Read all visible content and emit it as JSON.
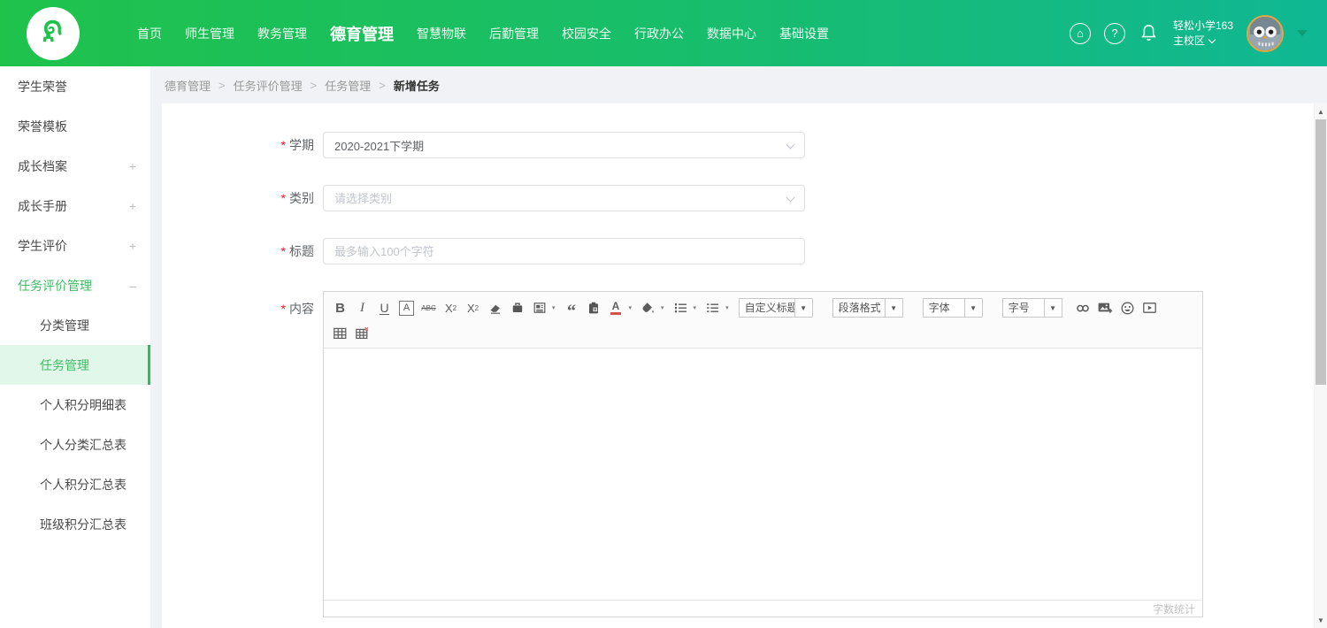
{
  "topnav": {
    "logo": "elephant-logo",
    "items": [
      {
        "label": "首页"
      },
      {
        "label": "师生管理"
      },
      {
        "label": "教务管理"
      },
      {
        "label": "德育管理",
        "active": true
      },
      {
        "label": "智慧物联"
      },
      {
        "label": "后勤管理"
      },
      {
        "label": "校园安全"
      },
      {
        "label": "行政办公"
      },
      {
        "label": "数据中心"
      },
      {
        "label": "基础设置"
      }
    ],
    "help_icon_glyph": "?",
    "home_icon_glyph": "⌂",
    "school_name": "轻松小学163",
    "campus": "主校区"
  },
  "sidebar": {
    "items": [
      {
        "label": "学生荣誉"
      },
      {
        "label": "荣誉模板"
      },
      {
        "label": "成长档案",
        "expander": "+"
      },
      {
        "label": "成长手册",
        "expander": "+"
      },
      {
        "label": "学生评价",
        "expander": "+"
      },
      {
        "label": "任务评价管理",
        "expander": "–",
        "active": true
      },
      {
        "label": "分类管理",
        "sub": true
      },
      {
        "label": "任务管理",
        "sub": true,
        "active": true
      },
      {
        "label": "个人积分明细表",
        "sub": true
      },
      {
        "label": "个人分类汇总表",
        "sub": true
      },
      {
        "label": "个人积分汇总表",
        "sub": true
      },
      {
        "label": "班级积分汇总表",
        "sub": true
      }
    ]
  },
  "breadcrumb": {
    "separator": ">",
    "items": [
      "德育管理",
      "任务评价管理",
      "任务管理",
      "新增任务"
    ]
  },
  "form": {
    "required_mark": "*",
    "semester": {
      "label": "学期",
      "value": "2020-2021下学期"
    },
    "category": {
      "label": "类别",
      "placeholder": "请选择类别"
    },
    "title": {
      "label": "标题",
      "placeholder": "最多输入100个字符"
    },
    "content": {
      "label": "内容"
    }
  },
  "editor": {
    "toolbar_icons_row1": [
      "bold",
      "italic",
      "underline",
      "boxed-a",
      "strikethrough",
      "superscript",
      "subscript",
      "eraser",
      "paste",
      "content-block",
      "blockquote",
      "paste-as-text",
      "font-color",
      "fill-color",
      "ordered-list",
      "unordered-list",
      "link",
      "insert-image",
      "emoji",
      "video"
    ],
    "toolbar_icons_row2": [
      "insert-table",
      "delete-table"
    ],
    "dropdowns": [
      {
        "label": "自定义标题"
      },
      {
        "label": "段落格式"
      },
      {
        "label": "字体"
      },
      {
        "label": "字号"
      }
    ],
    "glyphs": {
      "bold": "B",
      "italic": "I",
      "underline": "U",
      "boxed_a": "A",
      "strike": "ABC",
      "sup_base": "X",
      "sub_base": "X",
      "sup_mark": "2",
      "sub_mark": "2",
      "quote": "“",
      "font_color_a": "A"
    },
    "content_value": "",
    "word_count_label": "字数统计"
  },
  "colors": {
    "brand_green_left": "#1fc24b",
    "brand_green_right": "#10b794",
    "accent_green": "#2ebd59",
    "active_menu_bg": "#e1f7e9",
    "required_red": "#f5222d",
    "page_bg": "#f0f2f5"
  }
}
